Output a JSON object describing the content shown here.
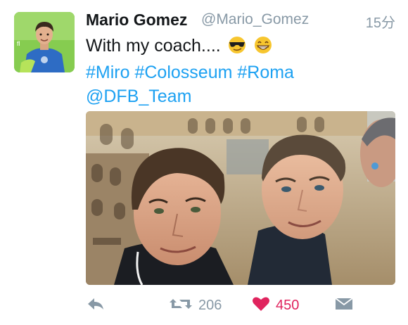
{
  "tweet": {
    "author_name": "Mario Gomez",
    "author_handle": "@Mario_Gomez",
    "timestamp": "15分",
    "text_line1": "With my coach....",
    "hashtags": [
      "#Miro",
      "#Colosseum",
      "#Roma"
    ],
    "mention": "@DFB_Team",
    "emojis": [
      "smiling-face-with-sunglasses-icon",
      "grinning-face-icon"
    ]
  },
  "actions": {
    "retweet_count": "206",
    "like_count": "450"
  },
  "colors": {
    "link": "#1da1f2",
    "like": "#e0245e",
    "muted": "#8899a6"
  }
}
